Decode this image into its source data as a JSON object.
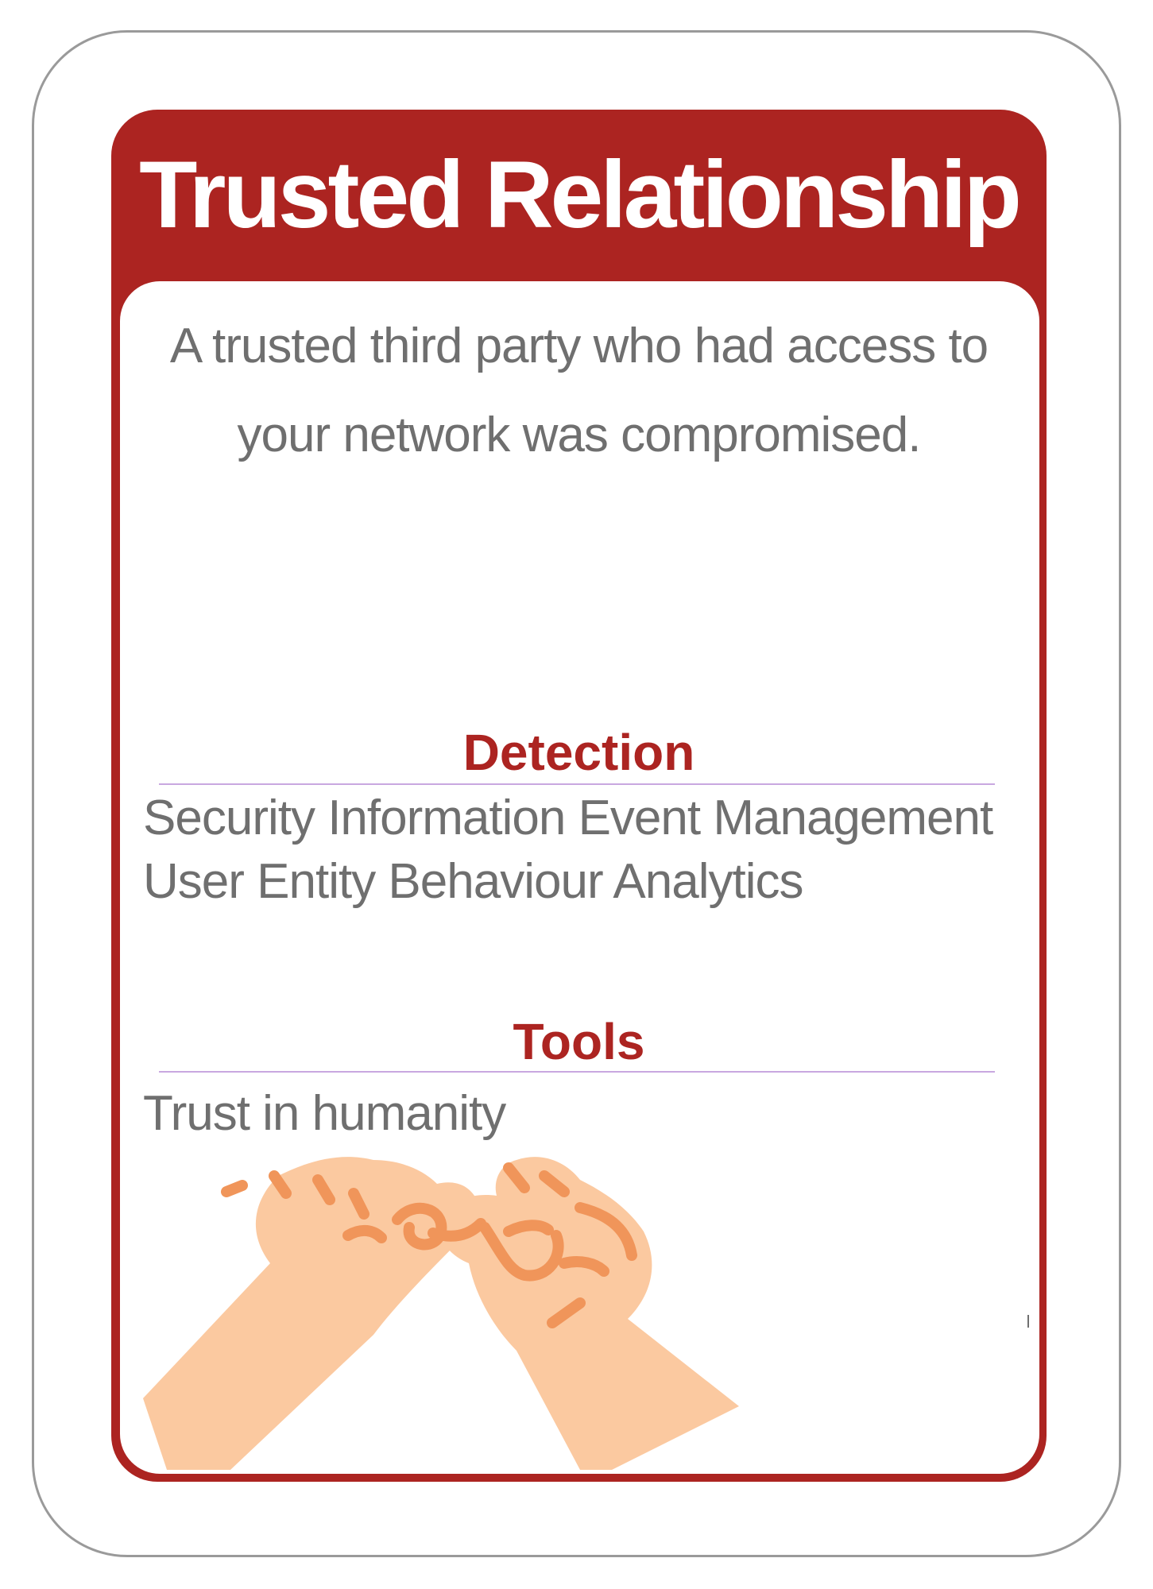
{
  "card": {
    "title": "Trusted Relationship",
    "description_lines": [
      "A trusted third party who had access to",
      "your network was compromised."
    ],
    "detection": {
      "heading": "Detection",
      "items": [
        "Security Information Event Management",
        "User Entity Behaviour Analytics"
      ]
    },
    "tools": {
      "heading": "Tools",
      "items": [
        "Trust in humanity"
      ]
    },
    "illustration": "pinky-promise-hands-icon"
  },
  "colors": {
    "accent": "#ac2421",
    "text": "#6f6f6f",
    "divider": "#c9a8e0",
    "skin": "#fbc9a0",
    "skin_line": "#f0955a"
  }
}
